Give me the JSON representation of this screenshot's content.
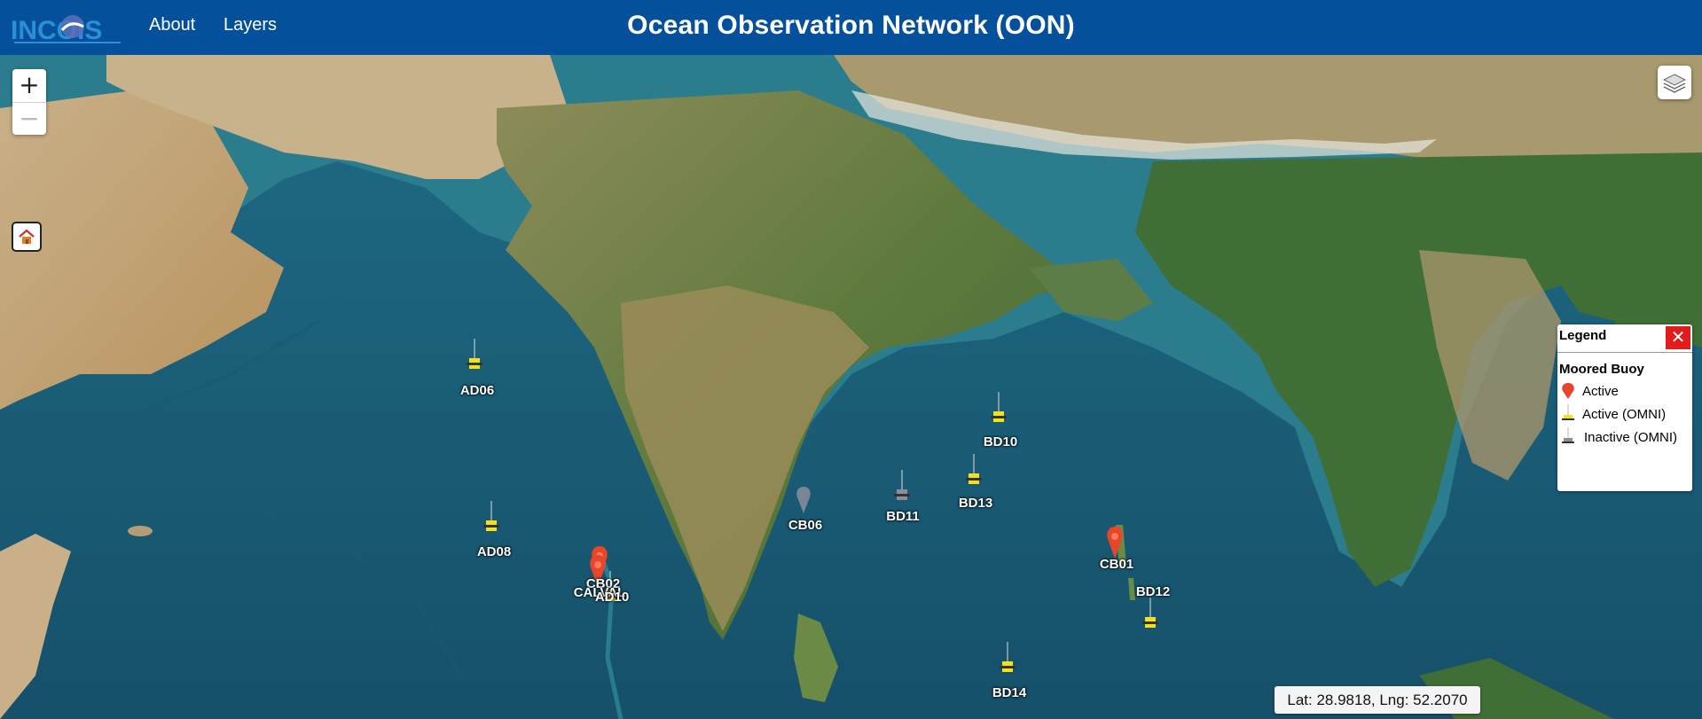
{
  "header": {
    "logo_text": "INCOIS",
    "nav": {
      "about": "About",
      "layers": "Layers"
    },
    "title": "Ocean Observation Network (OON)"
  },
  "map": {
    "zoom_in": "+",
    "zoom_out": "−",
    "coordinates": "Lat: 28.9818, Lng: 52.2070",
    "markers": [
      {
        "id": "AD06",
        "status": "active-omni"
      },
      {
        "id": "AD08",
        "status": "active-omni"
      },
      {
        "id": "CB02",
        "status": "active"
      },
      {
        "id": "CALVAL",
        "status": "active"
      },
      {
        "id": "AD10",
        "status": "active-omni"
      },
      {
        "id": "CB06",
        "status": "inactive-omni"
      },
      {
        "id": "BD10",
        "status": "active-omni"
      },
      {
        "id": "BD11",
        "status": "inactive-omni"
      },
      {
        "id": "BD13",
        "status": "active-omni"
      },
      {
        "id": "CB01",
        "status": "active"
      },
      {
        "id": "BD12",
        "status": "active-omni"
      },
      {
        "id": "BD14",
        "status": "active-omni"
      }
    ]
  },
  "legend": {
    "title": "Legend",
    "close": "✕",
    "section": "Moored Buoy",
    "items": [
      {
        "label": "Active",
        "icon": "red-buoy-icon"
      },
      {
        "label": "Active (OMNI)",
        "icon": "yellow-omni-buoy-icon"
      },
      {
        "label": "Inactive (OMNI)",
        "icon": "grey-omni-buoy-icon"
      }
    ]
  },
  "colors": {
    "header": "#04509a",
    "active": "#e8452b",
    "active_omni": "#f2e21a",
    "inactive_omni": "#8a8f99",
    "ocean": "#1f5f78",
    "land": "#8f8a55"
  }
}
